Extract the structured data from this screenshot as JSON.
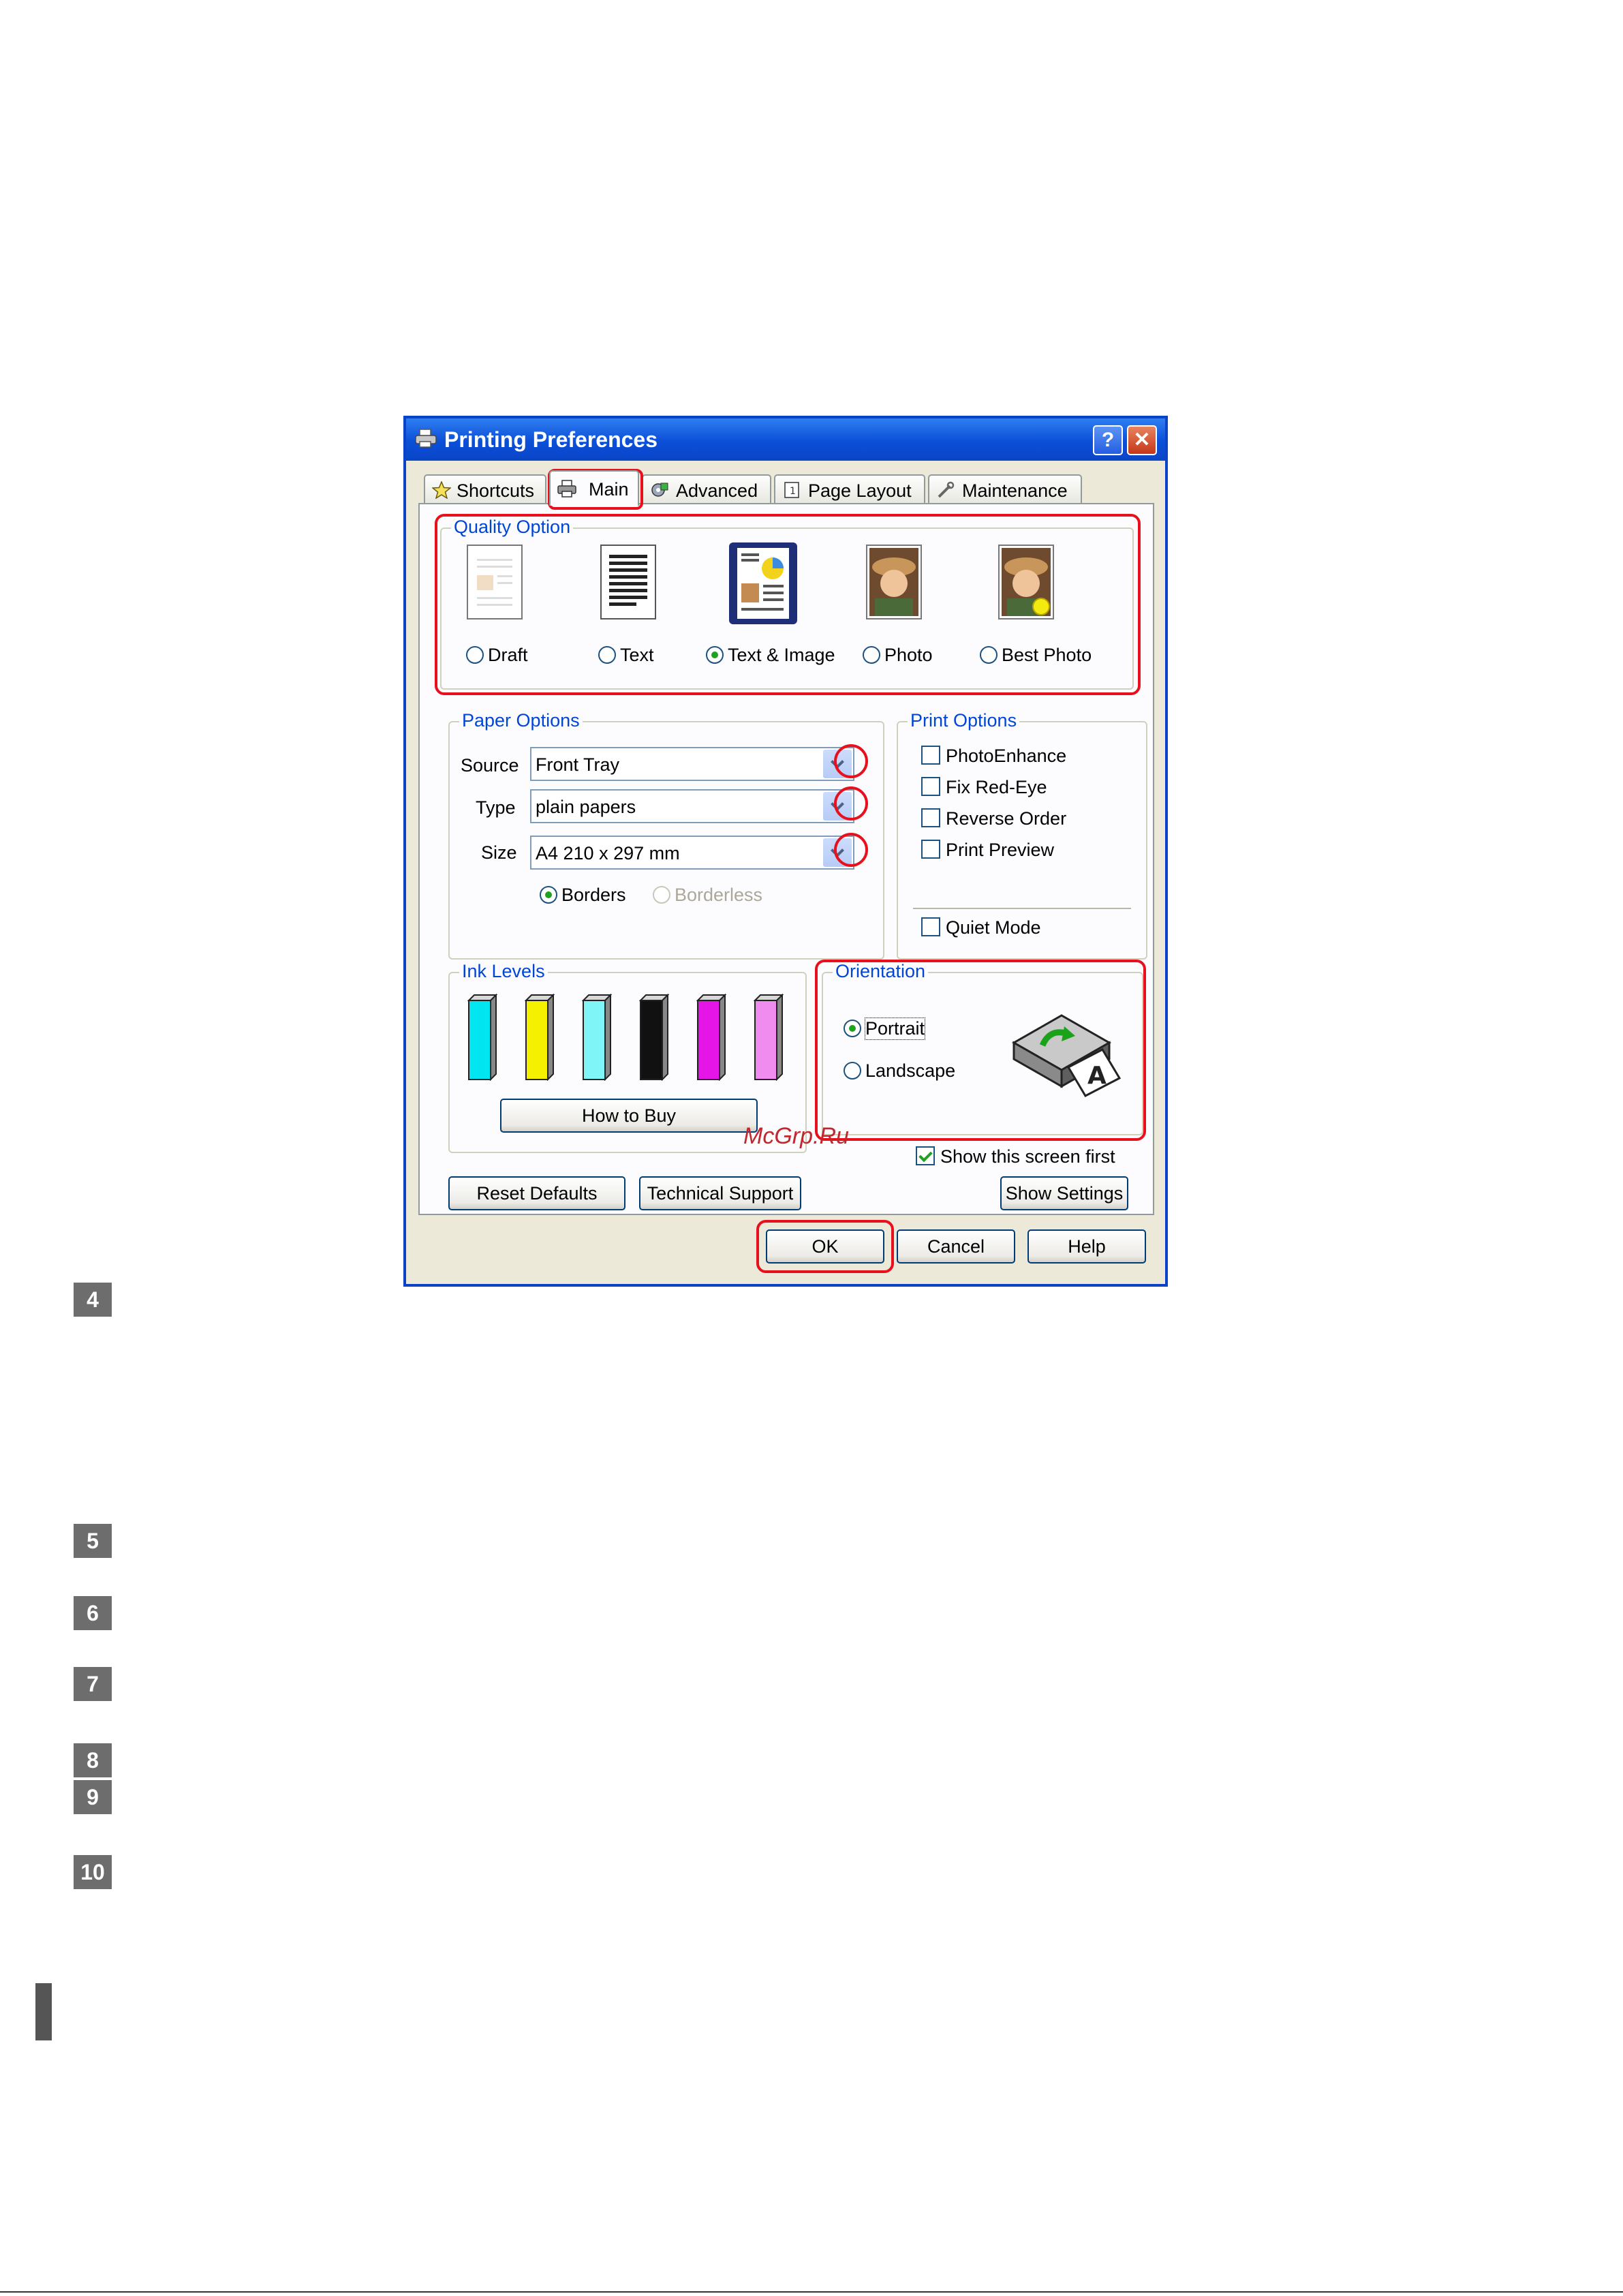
{
  "dialog": {
    "title": "Printing Preferences",
    "help_glyph": "?",
    "close_glyph": "✕",
    "tabs": [
      {
        "label": "Shortcuts",
        "icon": "star-icon"
      },
      {
        "label": "Main",
        "icon": "printer-icon",
        "active": true
      },
      {
        "label": "Advanced",
        "icon": "settings-icon"
      },
      {
        "label": "Page Layout",
        "icon": "page-icon"
      },
      {
        "label": "Maintenance",
        "icon": "wrench-icon"
      }
    ],
    "quality": {
      "label": "Quality Option",
      "options": [
        "Draft",
        "Text",
        "Text & Image",
        "Photo",
        "Best Photo"
      ],
      "selected": "Text & Image"
    },
    "paper": {
      "label": "Paper Options",
      "source_label": "Source",
      "source_value": "Front Tray",
      "type_label": "Type",
      "type_value": "plain papers",
      "size_label": "Size",
      "size_value": "A4 210 x 297 mm",
      "borders": "Borders",
      "borderless": "Borderless"
    },
    "print_options": {
      "label": "Print Options",
      "items": [
        "PhotoEnhance",
        "Fix Red-Eye",
        "Reverse Order",
        "Print Preview"
      ],
      "quiet_mode": "Quiet Mode"
    },
    "ink": {
      "label": "Ink Levels",
      "colors": [
        "#00e5f0",
        "#f5f000",
        "#7ff5f7",
        "#111111",
        "#e515e8",
        "#f08cf0"
      ],
      "how_to_buy": "How to Buy"
    },
    "orientation": {
      "label": "Orientation",
      "portrait": "Portrait",
      "landscape": "Landscape"
    },
    "show_screen_first": "Show this screen first",
    "reset_defaults": "Reset Defaults",
    "technical_support": "Technical Support",
    "show_settings": "Show Settings",
    "ok": "OK",
    "cancel": "Cancel",
    "help": "Help"
  },
  "watermark": "McGrp.Ru",
  "steps": [
    "4",
    "5",
    "6",
    "7",
    "8",
    "9",
    "10"
  ]
}
